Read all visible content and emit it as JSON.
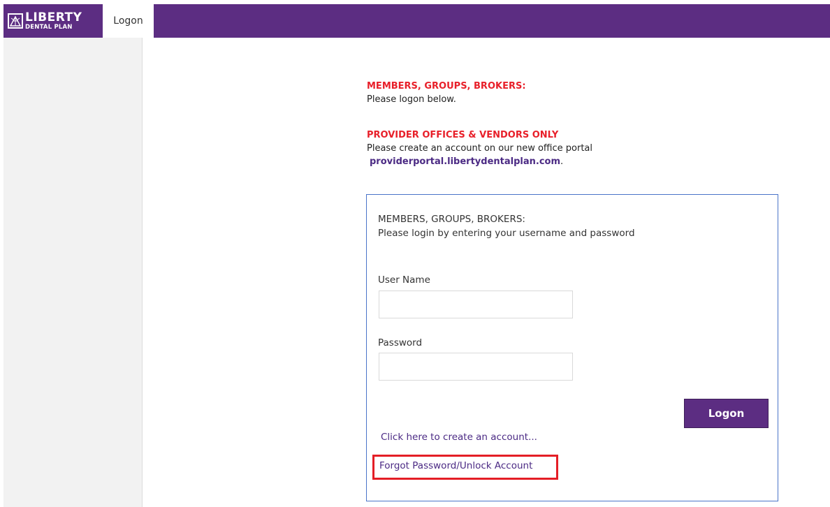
{
  "header": {
    "logo_line1": "LIBERTY",
    "logo_line2": "DENTAL PLAN",
    "logo_icon": "liberty-logo-mark",
    "tab_label": "Logon",
    "brand_color": "#5c2d82"
  },
  "notices": {
    "members_heading": "MEMBERS, GROUPS, BROKERS:",
    "members_text": "Please logon below.",
    "providers_heading": "PROVIDER OFFICES & VENDORS ONLY",
    "providers_text": "Please create an account on our new office portal",
    "providers_link": "providerportal.libertydentalplan.com",
    "providers_link_suffix": ".",
    "heading_color": "#e8202a"
  },
  "login": {
    "intro_line1": "MEMBERS, GROUPS, BROKERS:",
    "intro_line2": "Please login by entering your username and password",
    "username_label": "User Name",
    "username_value": "",
    "password_label": "Password",
    "password_value": "",
    "logon_button": "Logon",
    "create_account_link": "Click here to create an account...",
    "forgot_link": "Forgot Password/Unlock Account"
  }
}
